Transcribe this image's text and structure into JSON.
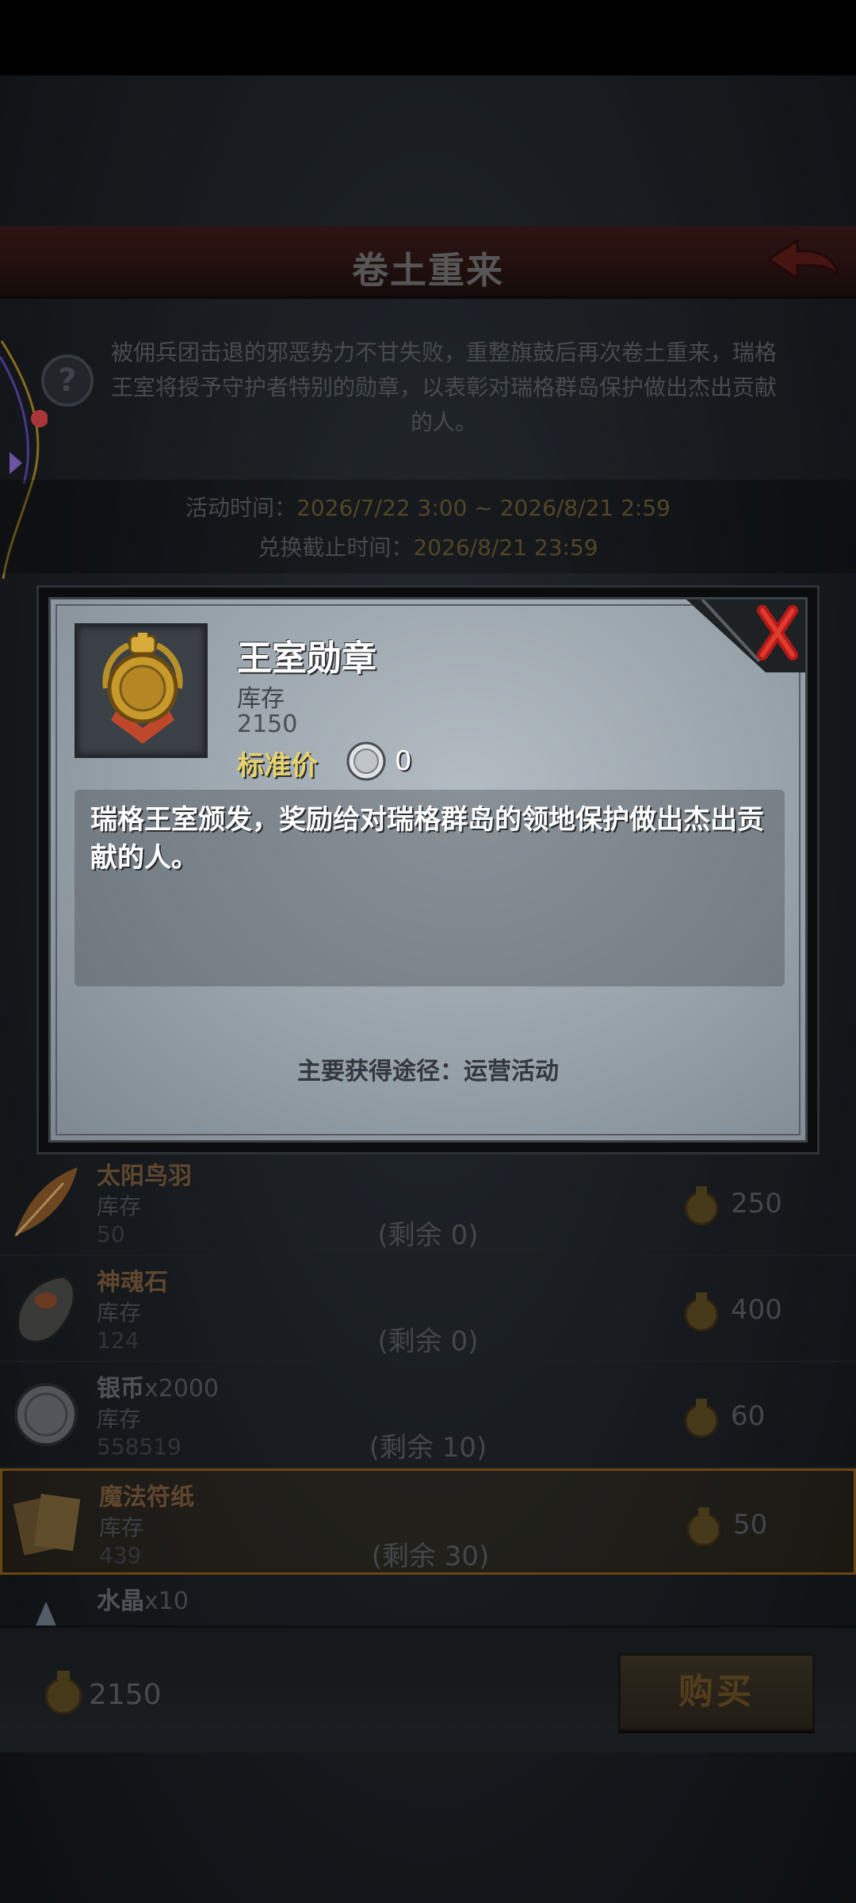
{
  "header": {
    "title": "卷土重来"
  },
  "event": {
    "description": "被佣兵团击退的邪恶势力不甘失败，重整旗鼓后再次卷土重来，瑞格王室将授予守护者特别的勋章，以表彰对瑞格群岛保护做出杰出贡献的人。",
    "time_label": "活动时间：",
    "time_value": "2026/7/22 3:00 ~ 2026/8/21 2:59",
    "deadline_label": "兑换截止时间：",
    "deadline_value": "2026/8/21 23:59"
  },
  "dialog": {
    "item_name": "王室勋章",
    "stock_label": "库存",
    "stock_value": "2150",
    "price_label": "标准价",
    "price_value": "0",
    "description": "瑞格王室颁发，奖励给对瑞格群岛的领地保护做出杰出贡献的人。",
    "source": "主要获得途径：运营活动",
    "close_icon": "close-x-icon"
  },
  "shop_items": [
    {
      "name": "太阳鸟羽",
      "qty": "",
      "stock_label": "库存",
      "stock": "50",
      "remain": "(剩余 0)",
      "price": "250",
      "icon": "feather-icon"
    },
    {
      "name": "神魂石",
      "qty": "",
      "stock_label": "库存",
      "stock": "124",
      "remain": "(剩余 0)",
      "price": "400",
      "icon": "soul-stone-icon"
    },
    {
      "name": "银币",
      "qty": "x2000",
      "stock_label": "库存",
      "stock": "558519",
      "remain": "(剩余 10)",
      "price": "60",
      "icon": "silver-coin-icon"
    },
    {
      "name": "魔法符纸",
      "qty": "",
      "stock_label": "库存",
      "stock": "439",
      "remain": "(剩余 30)",
      "price": "50",
      "icon": "magic-paper-icon"
    },
    {
      "name": "水晶",
      "qty": "x10",
      "stock_label": "",
      "stock": "",
      "remain": "",
      "price": "",
      "icon": "crystal-icon"
    }
  ],
  "footer": {
    "balance": "2150",
    "buy_label": "购买"
  },
  "colors": {
    "accent_gold": "#e7d36a",
    "close_red": "#c8201c",
    "selected_border": "#8a5a14"
  }
}
